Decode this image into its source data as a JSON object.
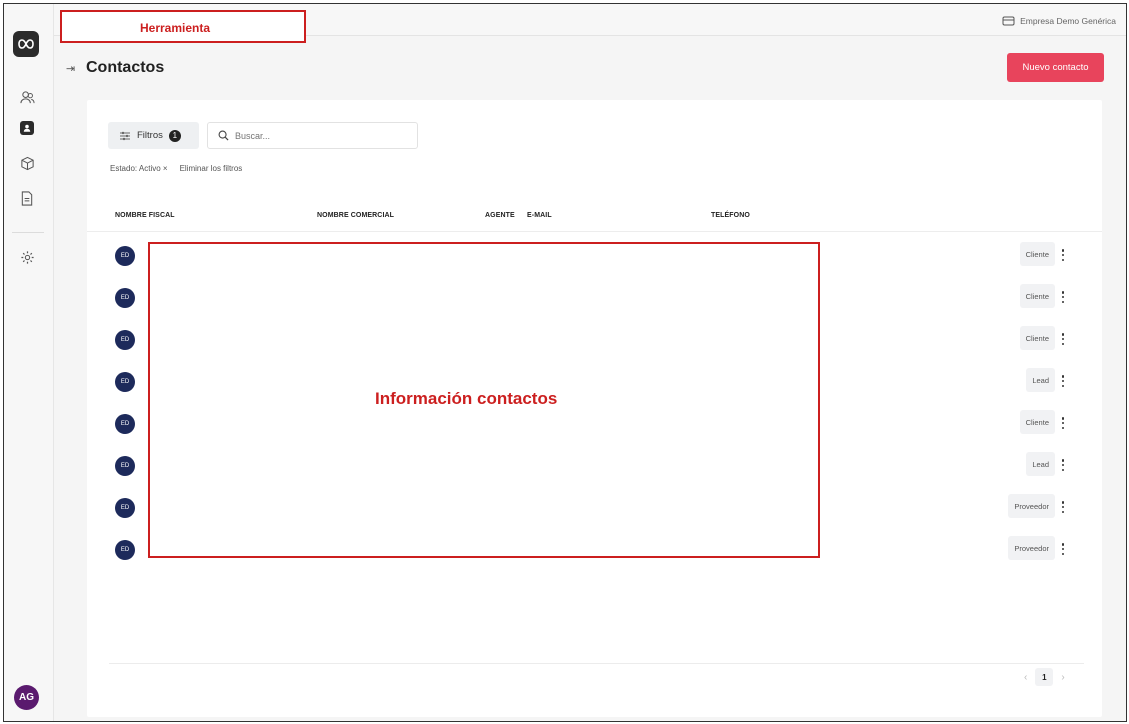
{
  "annotations": {
    "tool_label": "Herramienta",
    "contacts_label": "Información contactos"
  },
  "topbar": {
    "company": "Empresa Demo Genérica"
  },
  "sidebar": {
    "user_initials": "AG"
  },
  "header": {
    "title": "Contactos",
    "new_button": "Nuevo contacto"
  },
  "toolbar": {
    "filters_label": "Filtros",
    "filters_count": "1",
    "search_placeholder": "Buscar..."
  },
  "active_filters": {
    "chip": "Estado: Activo ×",
    "clear": "Eliminar los filtros"
  },
  "table": {
    "columns": [
      "NOMBRE FISCAL",
      "NOMBRE COMERCIAL",
      "AGENTE",
      "E-MAIL",
      "TELÉFONO"
    ],
    "rows": [
      {
        "initials": "ED",
        "type": "Cliente"
      },
      {
        "initials": "ED",
        "type": "Cliente"
      },
      {
        "initials": "ED",
        "type": "Cliente"
      },
      {
        "initials": "ED",
        "type": "Lead"
      },
      {
        "initials": "ED",
        "type": "Cliente"
      },
      {
        "initials": "ED",
        "type": "Lead"
      },
      {
        "initials": "ED",
        "type": "Proveedor"
      },
      {
        "initials": "ED",
        "type": "Proveedor"
      }
    ]
  },
  "pagination": {
    "prev": "‹",
    "current": "1",
    "next": "›"
  }
}
